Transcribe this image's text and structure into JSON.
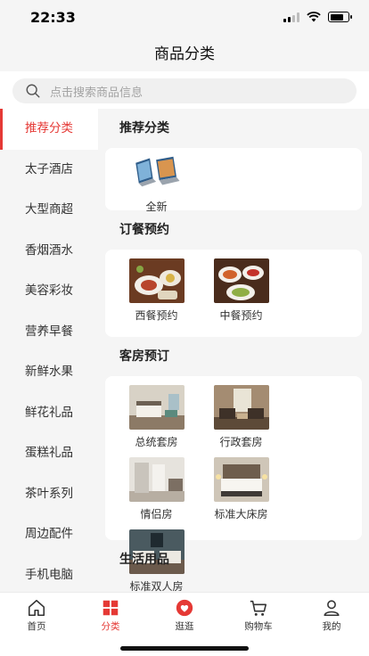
{
  "status_bar": {
    "time": "22:33"
  },
  "nav": {
    "title": "商品分类"
  },
  "search": {
    "placeholder": "点击搜索商品信息"
  },
  "sidebar": {
    "items": [
      {
        "label": "推荐分类",
        "active": true
      },
      {
        "label": "太子酒店"
      },
      {
        "label": "大型商超"
      },
      {
        "label": "香烟酒水"
      },
      {
        "label": "美容彩妆"
      },
      {
        "label": "营养早餐"
      },
      {
        "label": "新鲜水果"
      },
      {
        "label": "鲜花礼品"
      },
      {
        "label": "蛋糕礼品"
      },
      {
        "label": "茶叶系列"
      },
      {
        "label": "周边配件"
      },
      {
        "label": "手机电脑"
      }
    ]
  },
  "sections": [
    {
      "title": "推荐分类",
      "items": [
        {
          "label": "全新",
          "icon": "laptops-image"
        }
      ]
    },
    {
      "title": "订餐预约",
      "items": [
        {
          "label": "西餐预约",
          "icon": "western-food-image"
        },
        {
          "label": "中餐预约",
          "icon": "chinese-food-image"
        }
      ]
    },
    {
      "title": "客房预订",
      "items": [
        {
          "label": "总统套房",
          "icon": "room-image"
        },
        {
          "label": "行政套房",
          "icon": "room-image"
        },
        {
          "label": "情侣房",
          "icon": "room-image"
        },
        {
          "label": "标准大床房",
          "icon": "room-image"
        },
        {
          "label": "标准双人房",
          "icon": "room-image"
        }
      ]
    },
    {
      "title": "生活用品",
      "items": []
    }
  ],
  "tabbar": {
    "tabs": [
      {
        "label": "首页",
        "icon": "home-icon"
      },
      {
        "label": "分类",
        "icon": "category-icon",
        "active": true
      },
      {
        "label": "逛逛",
        "icon": "heart-badge-icon"
      },
      {
        "label": "购物车",
        "icon": "cart-icon"
      },
      {
        "label": "我的",
        "icon": "user-icon"
      }
    ]
  },
  "colors": {
    "accent": "#e53935",
    "background": "#f5f5f5",
    "card": "#ffffff"
  }
}
